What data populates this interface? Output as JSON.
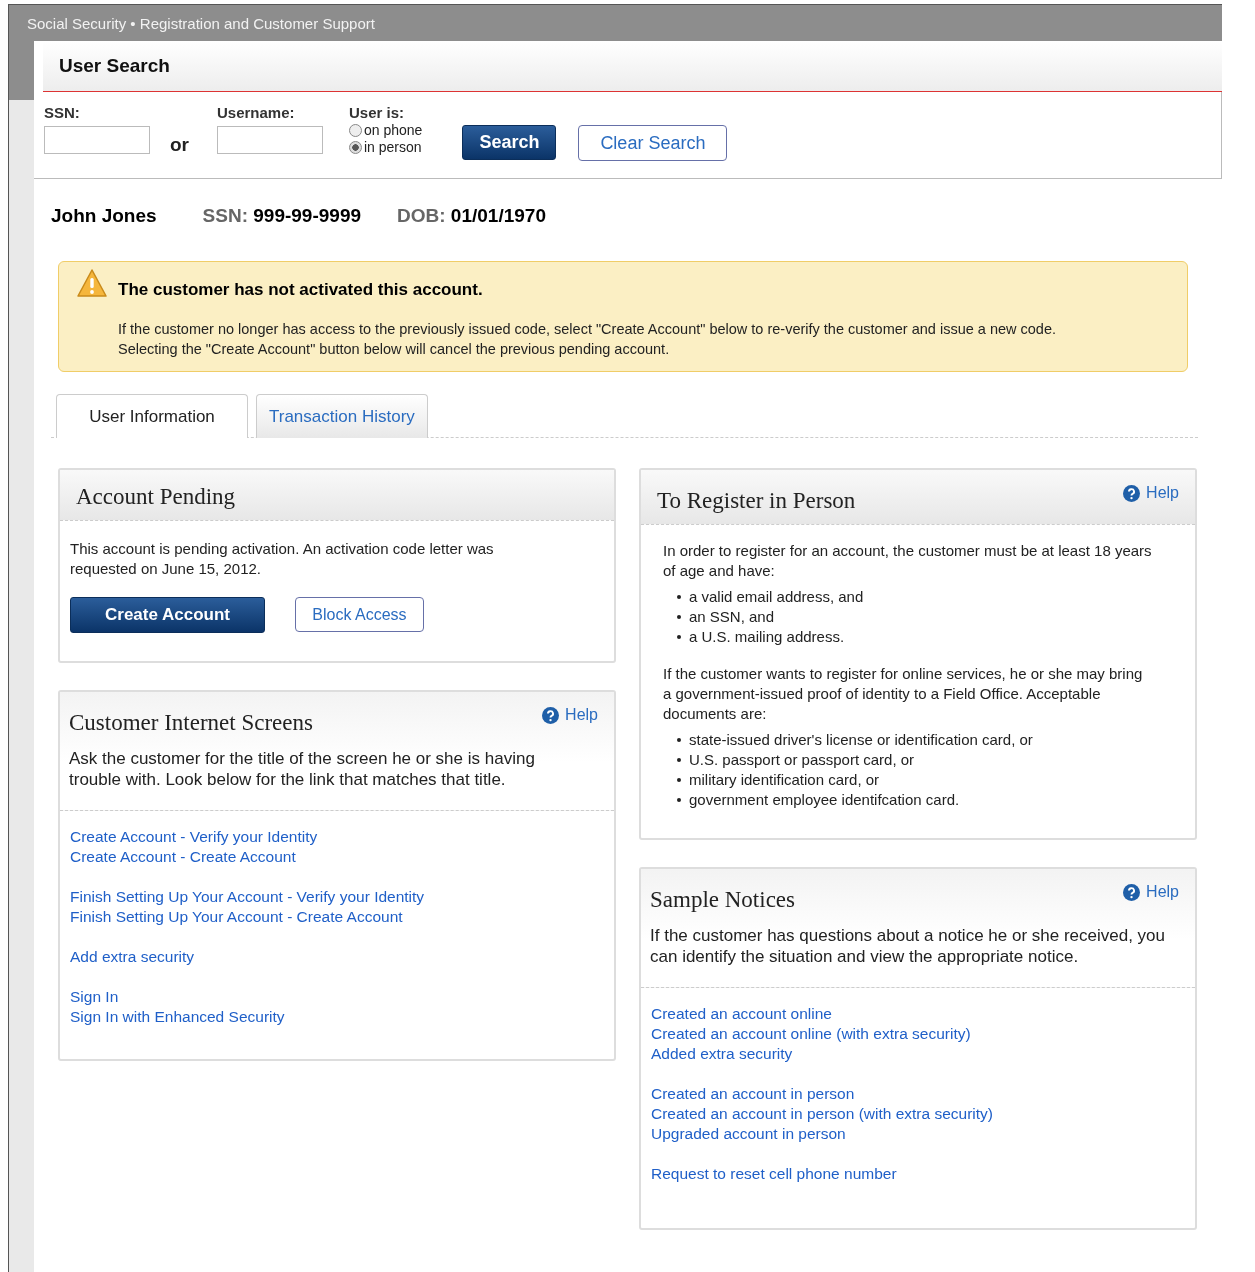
{
  "app_title": "Social Security • Registration and Customer Support",
  "search": {
    "title": "User Search",
    "ssn_label": "SSN:",
    "or": "or",
    "username_label": "Username:",
    "user_is_label": "User is:",
    "options": [
      {
        "label": "on phone",
        "selected": false
      },
      {
        "label": "in person",
        "selected": true
      }
    ],
    "search_button": "Search",
    "clear_button": "Clear Search"
  },
  "person": {
    "name": "John Jones",
    "ssn_label": "SSN:",
    "ssn": "999-99-9999",
    "dob_label": "DOB:",
    "dob": "01/01/1970"
  },
  "alert": {
    "title": "The customer has not activated this account.",
    "text": "If the customer no longer has access to the previously issued code, select \"Create Account\" below to re-verify the customer and issue a new code. Selecting the \"Create Account\" button below will cancel the previous pending account."
  },
  "tabs": [
    {
      "label": "User Information",
      "selected": true
    },
    {
      "label": "Transaction History",
      "selected": false
    }
  ],
  "account_pending": {
    "title": "Account Pending",
    "text": "This account is pending activation. An activation code letter was requested on June 15, 2012.",
    "primary_button": "Create Account",
    "secondary_button": "Block Access"
  },
  "customer_screens": {
    "title": "Customer Internet Screens",
    "help": "Help",
    "text": "Ask the customer for the title of the screen he or she is having trouble with. Look below for the link that matches that title.",
    "link_groups": [
      [
        "Create Account - Verify your Identity",
        "Create Account - Create Account"
      ],
      [
        "Finish Setting Up Your Account - Verify your Identity",
        "Finish Setting Up Your Account - Create Account"
      ],
      [
        "Add extra security"
      ],
      [
        "Sign In",
        "Sign In with Enhanced Security"
      ]
    ]
  },
  "register": {
    "title": "To Register in Person",
    "help": "Help",
    "intro": "In order to register for an account, the customer must be at least 18 years of age and have:",
    "requirements": [
      "a valid email address, and",
      "an SSN, and",
      "a U.S. mailing address."
    ],
    "documents_intro": "If the customer wants to register for online services, he or she may bring a government-issued proof of identity to a Field Office. Acceptable documents are:",
    "documents": [
      "state-issued driver's license or identification card, or",
      "U.S. passport or passport card, or",
      "military identification card, or",
      "government employee identifcation card."
    ]
  },
  "notices": {
    "title": "Sample Notices",
    "help": "Help",
    "text": "If the customer has questions about a notice he or she received, you can identify the situation and view the appropriate notice.",
    "link_groups": [
      [
        "Created an account online",
        "Created an account online (with extra security)",
        "Added extra security"
      ],
      [
        "Created an account in person",
        "Created an account in person (with extra security)",
        "Upgraded account in person"
      ],
      [
        "Request to reset cell phone number"
      ]
    ]
  }
}
